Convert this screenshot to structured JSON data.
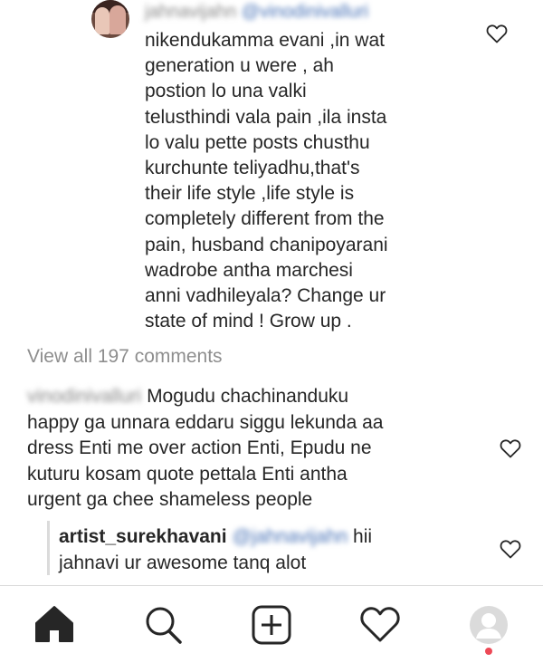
{
  "comment1": {
    "username": "jahnavijahn",
    "mention": "@vinodinivalluri",
    "text": "nikendukamma evani ,in wat\ngeneration u were , ah\npostion lo una valki\ntelusthindi vala pain ,ila insta\nlo valu pette posts chusthu\nkurchunte teliyadhu,that's\ntheir life style ,life style is\ncompletely different from the\npain, husband chanipoyarani\nwadrobe antha marchesi\nanni vadhileyala? Change ur\nstate of mind ! Grow up ."
  },
  "view_all": "View all 197 comments",
  "comment2": {
    "username": "vinodinivalluri",
    "text": "Mogudu chachinanduku\nhappy ga unnara eddaru siggu lekunda aa\ndress Enti me over action Enti, Epudu ne\nkuturu kosam quote pettala Enti antha\nurgent ga chee shameless people"
  },
  "comment3": {
    "username": "artist_surekhavani",
    "mention": "@jahnavijahn",
    "text_first": "hii",
    "text_rest": "jahnavi ur awesome tanq alot"
  },
  "icons": {
    "like": "heart-outline-icon",
    "home": "home-icon",
    "search": "search-icon",
    "add": "add-post-icon",
    "activity": "heart-activity-icon",
    "profile": "profile-avatar-icon"
  },
  "colors": {
    "text": "#262626",
    "muted": "#8e8e8e",
    "notification_dot": "#ed4956"
  }
}
